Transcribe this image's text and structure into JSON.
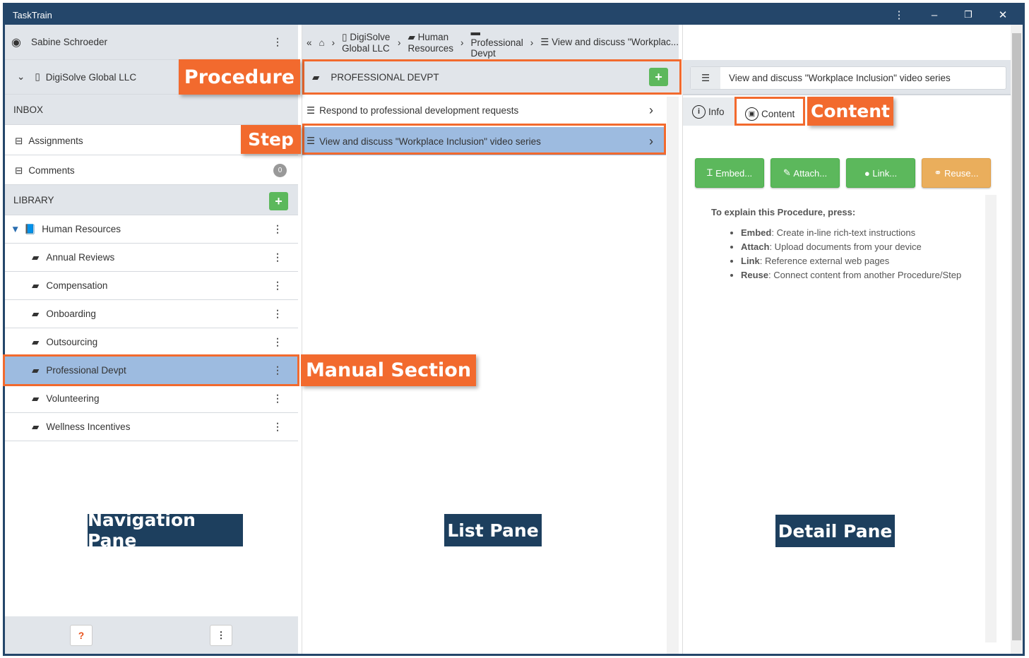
{
  "app": {
    "title": "TaskTrain"
  },
  "nav": {
    "user": "Sabine Schroeder",
    "org": "DigiSolve Global LLC",
    "inbox": "INBOX",
    "assignments": "Assignments",
    "comments": "Comments",
    "comments_count": "0",
    "library": "LIBRARY",
    "root": "Human Resources",
    "sections": [
      "Annual Reviews",
      "Compensation",
      "Onboarding",
      "Outsourcing",
      "Professional Devpt",
      "Volunteering",
      "Wellness Incentives"
    ],
    "selected_section": "Professional Devpt"
  },
  "breadcrumb": [
    "DigiSolve Global LLC",
    "Human Resources",
    "Professional Devpt",
    "View and discuss \"Workplac..."
  ],
  "list": {
    "header": "PROFESSIONAL DEVPT",
    "items": [
      "Respond to professional development requests",
      "View and discuss \"Workplace Inclusion\" video series"
    ]
  },
  "detail": {
    "title": "View and discuss \"Workplace Inclusion\" video series",
    "tabs": {
      "info": "Info",
      "content": "Content"
    },
    "buttons": {
      "embed": "Embed...",
      "attach": "Attach...",
      "link": "Link...",
      "reuse": "Reuse..."
    },
    "intro": "To explain this Procedure, press:",
    "bullets": [
      {
        "term": "Embed",
        "text": ": Create in-line rich-text instructions"
      },
      {
        "term": "Attach",
        "text": ": Upload documents from your device"
      },
      {
        "term": "Link",
        "text": ": Reference external web pages"
      },
      {
        "term": "Reuse",
        "text": ": Connect content from another Procedure/Step"
      }
    ]
  },
  "annotations": {
    "procedure": "Procedure",
    "step": "Step",
    "content": "Content",
    "manual_section": "Manual Section",
    "navigation_pane": "Navigation Pane",
    "list_pane": "List Pane",
    "detail_pane": "Detail Pane"
  },
  "colors": {
    "titlebar": "#24466a",
    "accent": "#f26a2e",
    "green": "#5cb85c",
    "orange": "#f0ad4e",
    "selected": "#9dbbe0"
  }
}
